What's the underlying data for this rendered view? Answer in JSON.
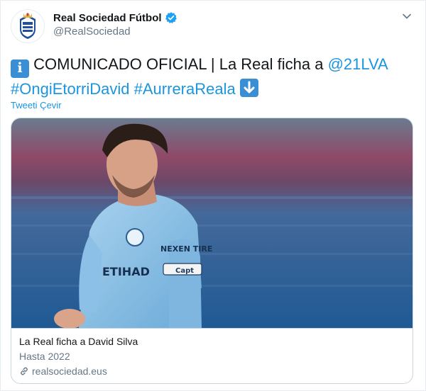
{
  "header": {
    "display_name": "Real Sociedad Fútbol",
    "handle": "@RealSociedad",
    "verified": true,
    "avatar_icon": "real-sociedad-crest-icon"
  },
  "tweet": {
    "emoji_info": "i",
    "text_main": "COMUNICADO OFICIAL | La Real ficha a",
    "mention": "@21LVA",
    "hashtag_1": "#OngiEtorriDavid",
    "hashtag_2": "#AurreraReala",
    "emoji_down_icon": "down-arrow-emoji-icon",
    "translate_label": "Tweeti Çevir"
  },
  "card": {
    "title": "La Real ficha a David Silva",
    "description": "Hasta 2022",
    "domain": "realsociedad.eus",
    "image_text": {
      "sponsor": "ETIHAD",
      "sleeve": "NEXEN TIRE",
      "armband": "Capt"
    }
  },
  "colors": {
    "link": "#1b95e0",
    "text": "#14171a",
    "muted": "#657786",
    "border": "#ccd6dd"
  }
}
